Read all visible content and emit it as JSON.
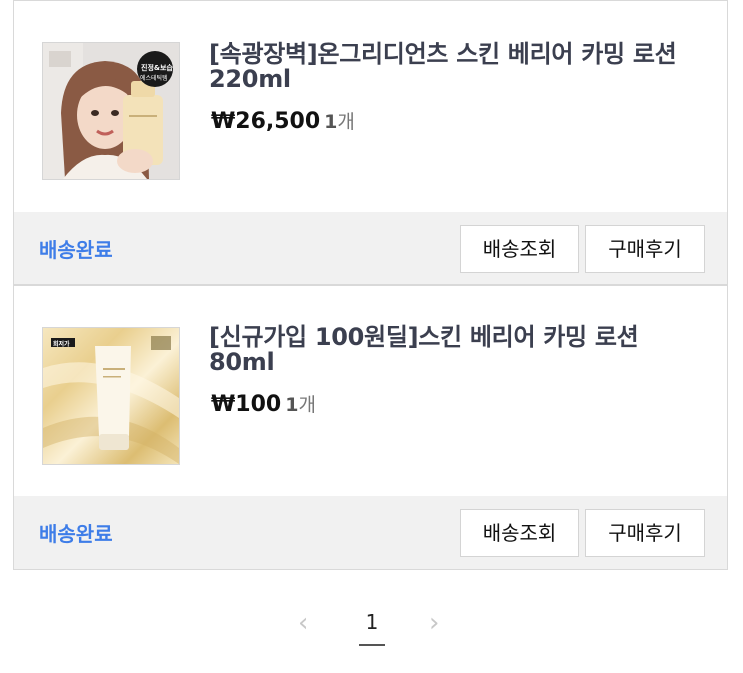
{
  "orders": [
    {
      "name": "[속광장벽]온그리디언츠 스킨 베리어 카밍 로션 220ml",
      "price": "₩26,500",
      "qty": "1",
      "qty_unit": "개",
      "thumb_badge": "진정&보습",
      "thumb_badge2": "에스테틱템",
      "status": "배송완료",
      "track_label": "배송조회",
      "review_label": "구매후기"
    },
    {
      "name": "[신규가입 100원딜]스킨 베리어 카밍 로션 80ml",
      "price": "₩100",
      "qty": "1",
      "qty_unit": "개",
      "thumb_badge": "회저가",
      "status": "배송완료",
      "track_label": "배송조회",
      "review_label": "구매후기"
    }
  ],
  "pager": {
    "prev": "‹",
    "current": "1",
    "next": "›"
  },
  "colors": {
    "status": "#3e7de8",
    "status_bar_bg": "#f1f1f1",
    "name_text": "#3b3f4f"
  }
}
